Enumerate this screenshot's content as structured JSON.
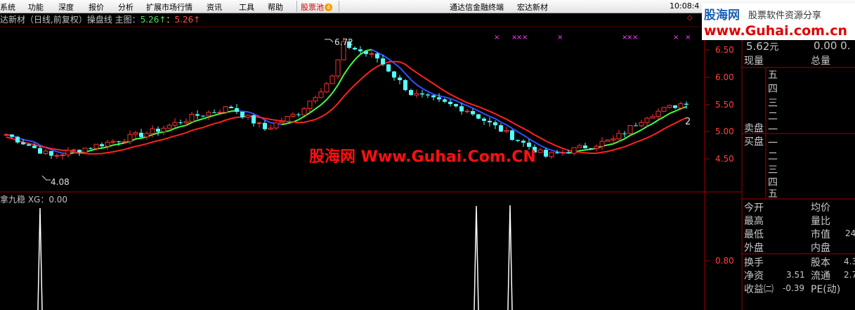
{
  "menu": {
    "items": [
      "系统",
      "功能",
      "深度",
      "报价",
      "分析",
      "扩展市场行情",
      "资讯",
      "工具",
      "帮助"
    ],
    "stock_pool": "股票池",
    "stock_pool_count": "4",
    "terminal_title": "通达信金融终端",
    "stock_name": "宏达新材",
    "clock": "10:08:4"
  },
  "logo": {
    "main": "股海网",
    "sub": "股票软件资源分享",
    "url": "www.Guhai.com.cn"
  },
  "chart": {
    "title_prefix": "达新材（日线,前复权）操盘线 主图：",
    "value_green": "5.26↑",
    "separator": "：",
    "value_red": "5.26↑",
    "high_label": "6.72",
    "low_label": "4.08",
    "signal_badge": "2",
    "watermark": "股海网 Www.Guhai.Com.CN",
    "y_axis_labels": [
      "6.50",
      "6.00",
      "5.50",
      "5.00",
      "4.50"
    ],
    "marker_char": "×"
  },
  "indicator": {
    "title": "拿九稳 XG：0.00",
    "axis_label": "0.80"
  },
  "panel": {
    "price": "5.62",
    "price_unit": "元",
    "price_right": "0.00 0.",
    "now_vol_label": "现量",
    "total_vol_label": "总量",
    "sell_label": "卖盘",
    "buy_label": "买盘",
    "sell_levels": [
      "五",
      "四",
      "三",
      "二",
      "一"
    ],
    "buy_levels": [
      "一",
      "二",
      "三",
      "四",
      "五"
    ],
    "stats_left": [
      "今开",
      "最高",
      "最低",
      "外盘"
    ],
    "stats_right": [
      "均价",
      "量比",
      "市值",
      "内盘"
    ],
    "market_value_partial": "24",
    "turnover_label": "换手",
    "share_capital_label": "股本",
    "share_capital_partial": "4.3",
    "net_asset_label": "净资",
    "net_asset_value": "3.51",
    "float_label": "流通",
    "float_partial": "2.7",
    "eps_label": "收益㈡",
    "eps_value": "-0.39",
    "pe_label": "PE(动)"
  }
}
